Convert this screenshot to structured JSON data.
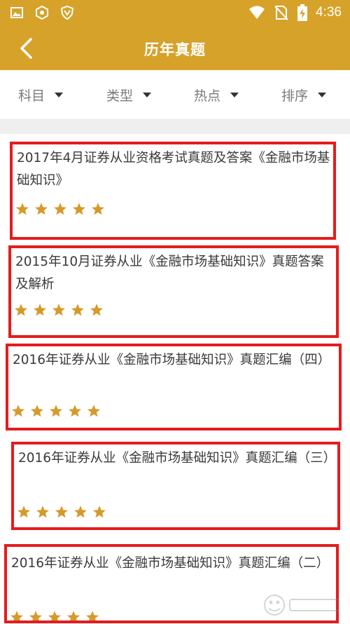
{
  "status_bar": {
    "time": "4:36",
    "left_icons": [
      "image-icon",
      "settings-ring-icon",
      "shield-v-icon"
    ],
    "right_icons": [
      "wifi-icon",
      "no-sim-icon",
      "battery-charging-icon"
    ]
  },
  "app_bar": {
    "title": "历年真题",
    "back_icon": "chevron-left-icon"
  },
  "filters": [
    {
      "label": "科目"
    },
    {
      "label": "类型"
    },
    {
      "label": "热点"
    },
    {
      "label": "排序"
    }
  ],
  "items": [
    {
      "title": "2017年4月证券从业资格考试真题及答案《金融市场基础知识》",
      "rating": 5,
      "max_rating": 5
    },
    {
      "title": "2015年10月证券从业《金融市场基础知识》真题答案及解析",
      "rating": 5,
      "max_rating": 5
    },
    {
      "title": "2016年证券从业《金融市场基础知识》真题汇编（四）",
      "rating": 5,
      "max_rating": 5
    },
    {
      "title": "2016年证券从业《金融市场基础知识》真题汇编（三）",
      "rating": 5,
      "max_rating": 5
    },
    {
      "title": "2016年证券从业《金融市场基础知识》真题汇编（二）",
      "rating": 5,
      "max_rating": 5
    }
  ],
  "colors": {
    "accent": "#d7a22a",
    "star": "#d69a2a",
    "highlight": "#e51c1c"
  }
}
